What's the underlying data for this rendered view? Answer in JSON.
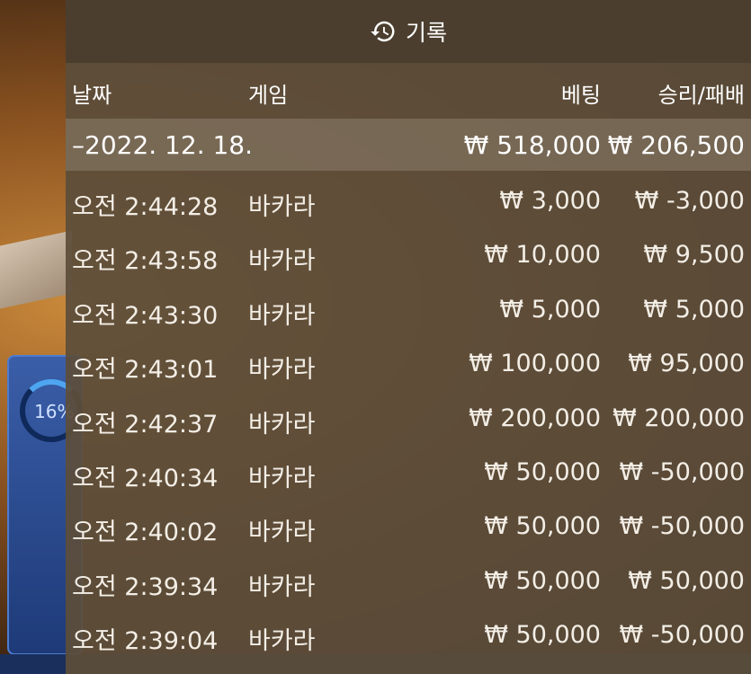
{
  "header": {
    "icon": "history-icon",
    "title": "기록"
  },
  "columns": {
    "date": "날짜",
    "game": "게임",
    "bet": "베팅",
    "result": "승리/패배"
  },
  "day_group": {
    "date": "–2022. 12. 18.",
    "bet_total": "₩ 518,000",
    "result_total": "₩ 206,500"
  },
  "rows": [
    {
      "time": "오전 2:44:28",
      "game": "바카라",
      "bet": "₩ 3,000",
      "result": "₩ -3,000"
    },
    {
      "time": "오전 2:43:58",
      "game": "바카라",
      "bet": "₩ 10,000",
      "result": "₩ 9,500"
    },
    {
      "time": "오전 2:43:30",
      "game": "바카라",
      "bet": "₩ 5,000",
      "result": "₩ 5,000"
    },
    {
      "time": "오전 2:43:01",
      "game": "바카라",
      "bet": "₩ 100,000",
      "result": "₩ 95,000"
    },
    {
      "time": "오전 2:42:37",
      "game": "바카라",
      "bet": "₩ 200,000",
      "result": "₩ 200,000"
    },
    {
      "time": "오전 2:40:34",
      "game": "바카라",
      "bet": "₩ 50,000",
      "result": "₩ -50,000"
    },
    {
      "time": "오전 2:40:02",
      "game": "바카라",
      "bet": "₩ 50,000",
      "result": "₩ -50,000"
    },
    {
      "time": "오전 2:39:34",
      "game": "바카라",
      "bet": "₩ 50,000",
      "result": "₩ 50,000"
    },
    {
      "time": "오전 2:39:04",
      "game": "바카라",
      "bet": "₩ 50,000",
      "result": "₩ -50,000"
    }
  ],
  "background": {
    "progress_label": "16%"
  },
  "colors": {
    "panel": "#5c4e3a",
    "header": "#4a3e2e",
    "day_row": "#8c806e",
    "text": "#ffffff"
  }
}
